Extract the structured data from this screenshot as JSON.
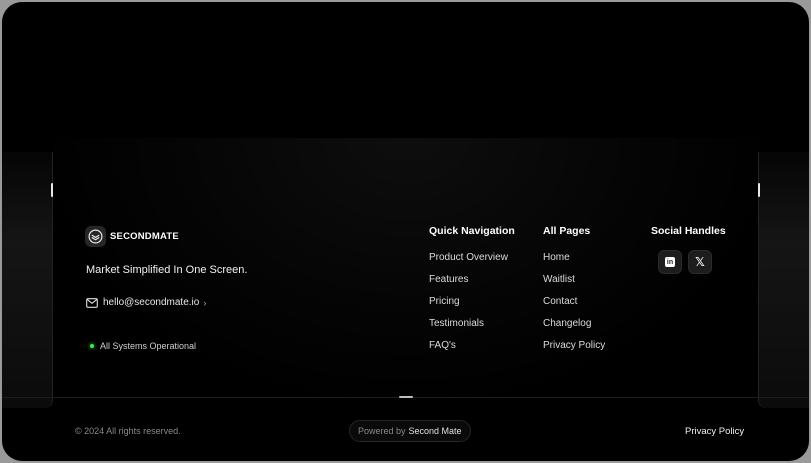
{
  "brand": {
    "name": "SECONDMATE",
    "tagline": "Market Simplified In One Screen."
  },
  "contact": {
    "email": "hello@secondmate.io"
  },
  "status": {
    "text": "All Systems Operational",
    "color": "#3ee65a"
  },
  "quick_nav": {
    "title": "Quick Navigation",
    "items": [
      "Product Overview",
      "Features",
      "Pricing",
      "Testimonials",
      "FAQ's"
    ]
  },
  "all_pages": {
    "title": "All Pages",
    "items": [
      "Home",
      "Waitlist",
      "Contact",
      "Changelog",
      "Privacy Policy"
    ]
  },
  "social": {
    "title": "Social Handles",
    "icons": [
      "linkedin-icon",
      "x-icon"
    ]
  },
  "footer": {
    "copyright": "© 2024 All rights reserved.",
    "powered_prefix": "Powered by",
    "powered_brand": "Second Mate",
    "privacy": "Privacy Policy"
  },
  "colors": {
    "background": "#000000",
    "frame": "#9a9a9a",
    "accent": "#3ee65a"
  }
}
